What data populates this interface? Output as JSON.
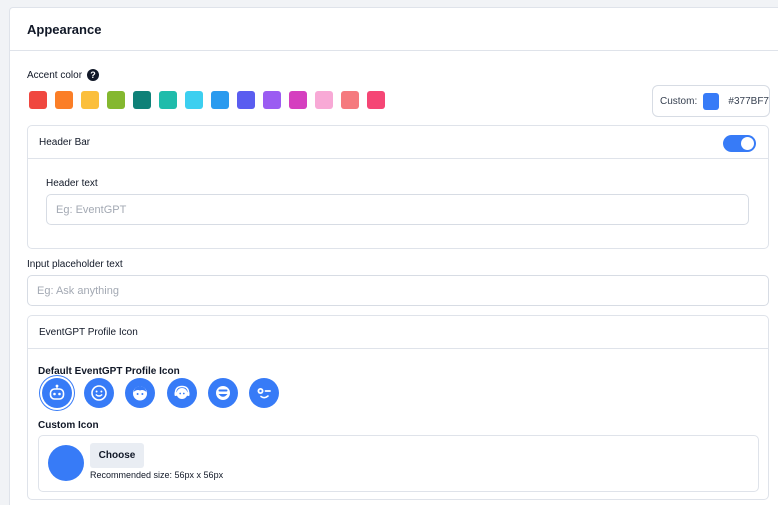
{
  "section": {
    "title": "Appearance"
  },
  "accent": {
    "label": "Accent color",
    "help_icon_glyph": "?",
    "colors": [
      "#f0473f",
      "#fb7e27",
      "#fbbf3c",
      "#84b82f",
      "#0f8178",
      "#1fbcab",
      "#3ccff0",
      "#2b9bef",
      "#5a5df0",
      "#9b5cf2",
      "#d53fbf",
      "#f8a9d6",
      "#f57a7e",
      "#f54675"
    ],
    "custom_label": "Custom:",
    "custom_color": "#377BF7",
    "custom_hex": "#377BF7"
  },
  "header_bar": {
    "title": "Header Bar",
    "toggle_on": true,
    "toggle_color": "#377bf7",
    "text_label": "Header text",
    "text_value": "",
    "text_placeholder": "Eg: EventGPT"
  },
  "input_placeholder": {
    "label": "Input placeholder text",
    "value": "",
    "placeholder": "Eg: Ask anything"
  },
  "profile_icon": {
    "title": "EventGPT Profile Icon",
    "default_label": "Default EventGPT Profile Icon",
    "icon_color": "#377bf7",
    "icons": [
      "robot-icon",
      "smile-icon",
      "bear-face-icon",
      "headset-face-icon",
      "grin-icon",
      "wink-icon"
    ],
    "selected_index": 0,
    "custom_label": "Custom Icon",
    "choose_label": "Choose",
    "recommended": "Recommended size: 56px x 56px"
  }
}
